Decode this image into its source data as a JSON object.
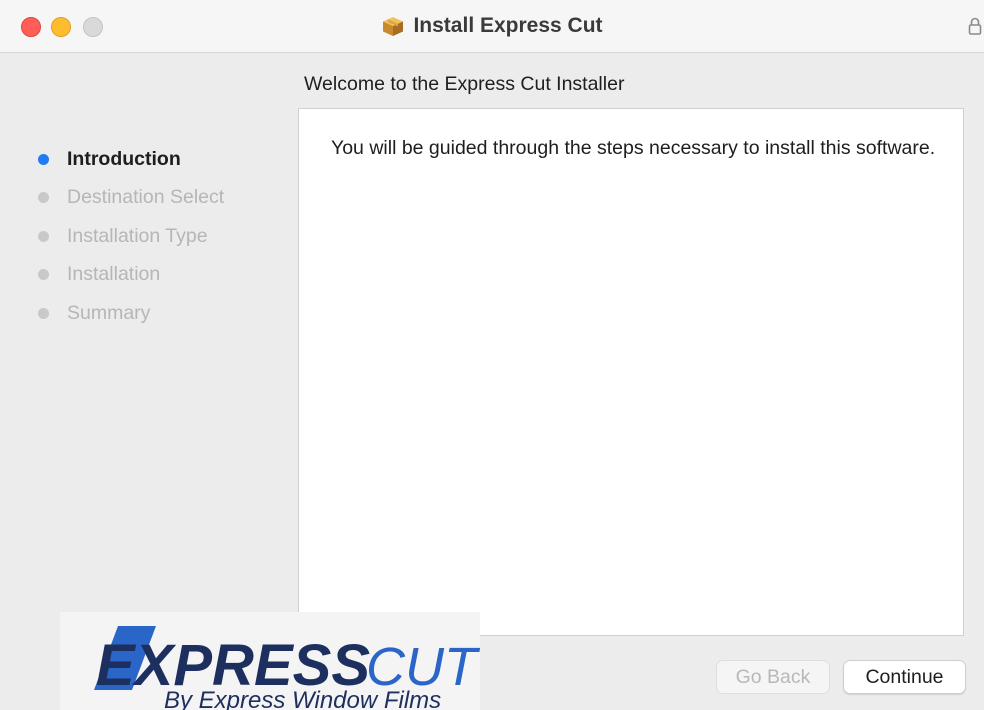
{
  "window": {
    "title": "Install Express Cut"
  },
  "main": {
    "heading": "Welcome to the Express Cut Installer",
    "body_text": "You will be guided through the steps necessary to install this software."
  },
  "sidebar": {
    "steps": [
      {
        "label": "Introduction",
        "active": true
      },
      {
        "label": "Destination Select",
        "active": false
      },
      {
        "label": "Installation Type",
        "active": false
      },
      {
        "label": "Installation",
        "active": false
      },
      {
        "label": "Summary",
        "active": false
      }
    ]
  },
  "logo": {
    "express_text": "EXPRESS",
    "cut_text": "CUT",
    "tagline": "By Express Window Films"
  },
  "buttons": {
    "back_label": "Go Back",
    "continue_label": "Continue"
  },
  "colors": {
    "accent": "#1f7cf5",
    "logo_navy": "#1d2f5e",
    "logo_blue": "#2a66c8"
  },
  "icons": {
    "title": "package-icon",
    "lock": "lock-icon"
  }
}
